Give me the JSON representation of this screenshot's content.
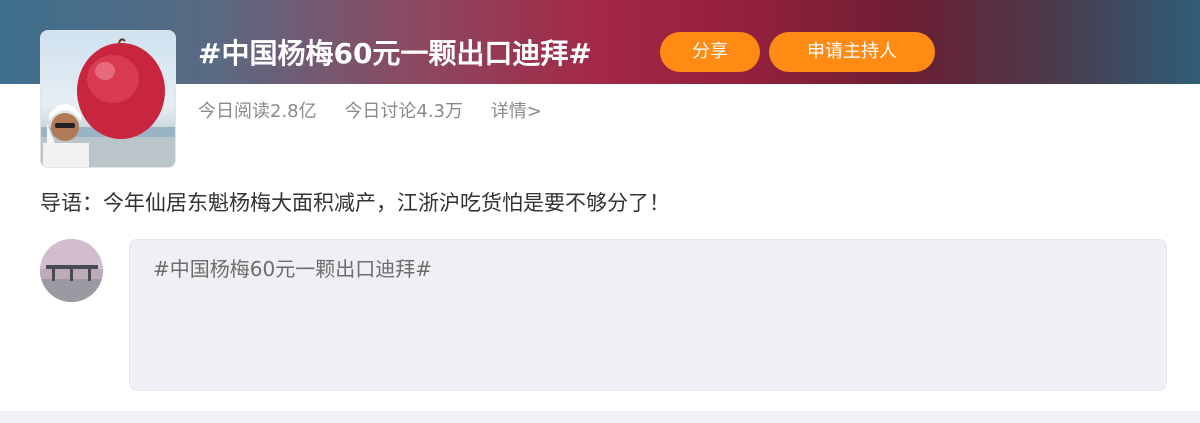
{
  "topic": {
    "title": "#中国杨梅60元一颗出口迪拜#",
    "share_label": "分享",
    "host_label": "申请主持人",
    "reads": "今日阅读2.8亿",
    "discussions": "今日讨论4.3万",
    "detail_link": "详情>",
    "guide": "导语：今年仙居东魁杨梅大面积减产，江浙沪吃货怕是要不够分了！"
  },
  "composer": {
    "text": "#中国杨梅60元一颗出口迪拜#"
  },
  "colors": {
    "accent_orange": "#ff8a14",
    "banner_red": "#a32845",
    "banner_blue": "#3c6f8d",
    "compose_bg": "#eff0f3"
  },
  "icons": {
    "topic_avatar": "bayberry-photo-icon",
    "user_avatar": "user-avatar-icon"
  }
}
